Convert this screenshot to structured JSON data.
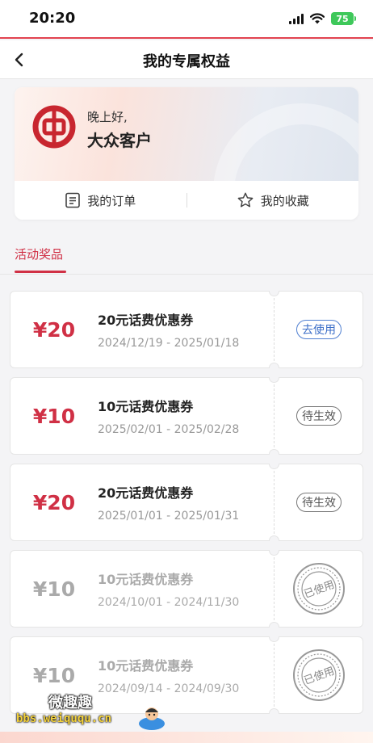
{
  "status_bar": {
    "time": "20:20",
    "battery": "75",
    "icons": [
      "signal-icon",
      "wifi-icon",
      "battery-icon"
    ]
  },
  "nav": {
    "title": "我的专属权益",
    "back_icon": "chevron-left-icon"
  },
  "profile": {
    "greeting": "晚上好,",
    "level": "大众客户",
    "logo": "bank-of-china-logo",
    "links": [
      {
        "label": "我的订单",
        "icon": "order-list-icon"
      },
      {
        "label": "我的收藏",
        "icon": "star-icon"
      }
    ]
  },
  "tabs": {
    "active": "活动奖品"
  },
  "coupons": [
    {
      "amount": "¥20",
      "title": "20元话费优惠券",
      "date": "2024/12/19 - 2025/01/18",
      "status": "去使用",
      "state": "usable"
    },
    {
      "amount": "¥10",
      "title": "10元话费优惠券",
      "date": "2025/02/01 - 2025/02/28",
      "status": "待生效",
      "state": "pending"
    },
    {
      "amount": "¥20",
      "title": "20元话费优惠券",
      "date": "2025/01/01 - 2025/01/31",
      "status": "待生效",
      "state": "pending"
    },
    {
      "amount": "¥10",
      "title": "10元话费优惠券",
      "date": "2024/10/01 - 2024/11/30",
      "status": "已使用",
      "state": "used"
    },
    {
      "amount": "¥10",
      "title": "10元话费优惠券",
      "date": "2024/09/14 - 2024/09/30",
      "status": "已使用",
      "state": "used"
    }
  ],
  "watermark": {
    "line1": "微趣趣",
    "line2": "bbs.weiququ.cn"
  },
  "colors": {
    "brand_red": "#d03045",
    "link_blue": "#3d6fc8",
    "battery_green": "#3ec85a"
  }
}
